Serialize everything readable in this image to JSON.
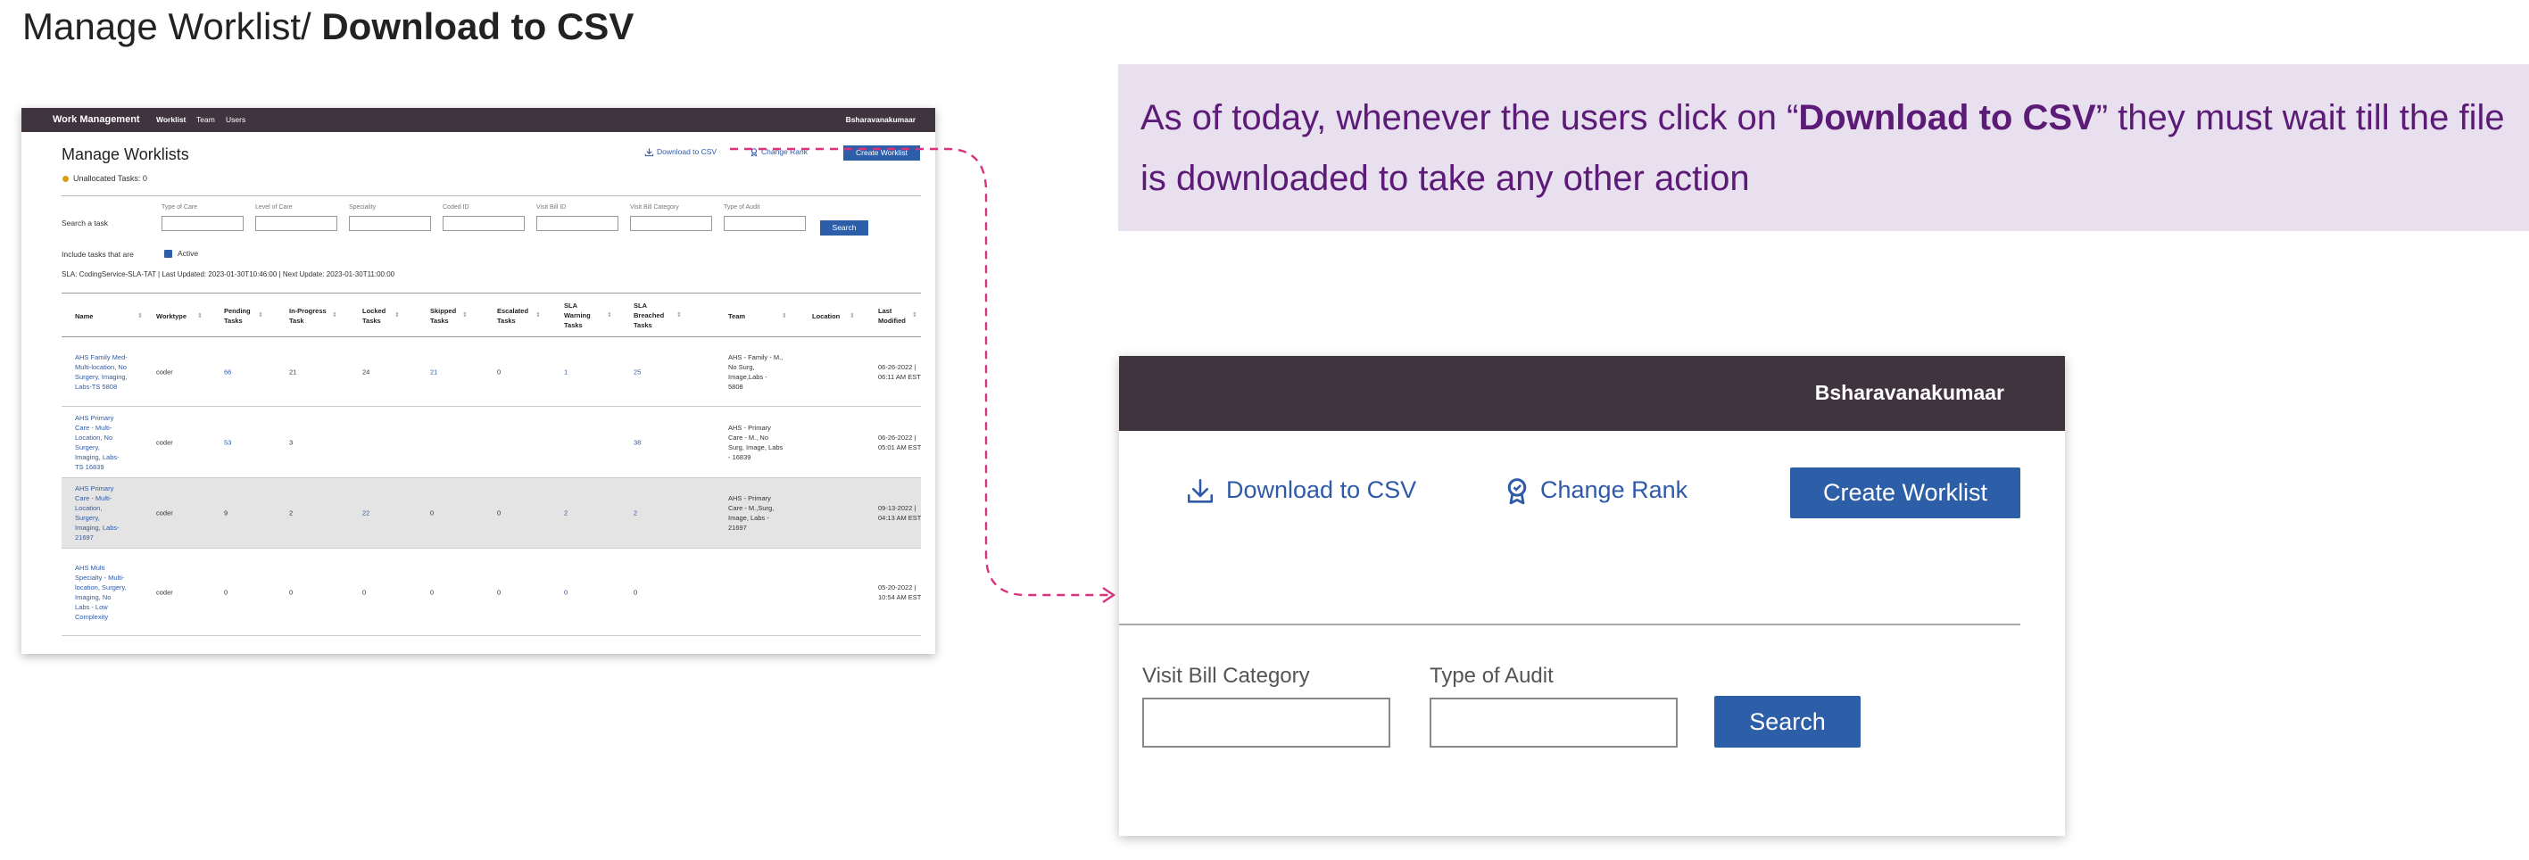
{
  "header": {
    "title_prefix": "Manage Worklist/ ",
    "title_bold": "Download to CSV"
  },
  "mini": {
    "nav": {
      "brand": "Work Management",
      "links": [
        "Worklist",
        "Team",
        "Users"
      ],
      "user": "Bsharavanakumaar"
    },
    "title": "Manage Worklists",
    "unallocated": "Unallocated Tasks: 0",
    "actions": {
      "download": "Download to CSV",
      "change_rank": "Change Rank",
      "create": "Create Worklist"
    },
    "search_label": "Search a task",
    "fields": [
      "Type of Care",
      "Level of Care",
      "Speciality",
      "Coded ID",
      "Visit Bill ID",
      "Visit Bill Category",
      "Type of Audit"
    ],
    "search_button": "Search",
    "include_label": "Include tasks that are",
    "active_label": "Active",
    "sla_line": "SLA: CodingService-SLA-TAT | Last Updated: 2023-01-30T10:46:00 | Next Update: 2023-01-30T11:00:00",
    "columns": [
      "Name",
      "Worktype",
      "Pending Tasks",
      "In-Progress Task",
      "Locked Tasks",
      "Skipped Tasks",
      "Escalated Tasks",
      "SLA Warning Tasks",
      "SLA Breached Tasks",
      "Team",
      "Location",
      "Last Modified"
    ],
    "rows": [
      {
        "name": "AHS Family Med-Multi-location, No Surgery, Imaging, Labs-TS 5808",
        "worktype": "coder",
        "pending": "66",
        "inprogress": "21",
        "locked": "24",
        "skipped": "21",
        "escalated": "0",
        "sla_warning": "1",
        "sla_breached": "25",
        "team": "AHS - Family - M., No Surg, Image,Labs - 5808",
        "location": "",
        "modified": "06-26-2022 | 06:11 AM EST"
      },
      {
        "name": "AHS Primary Care - Multi-Location, No Surgery, Imaging, Labs-TS 16839",
        "worktype": "coder",
        "pending": "53",
        "inprogress": "3",
        "locked": "",
        "skipped": "",
        "escalated": "",
        "sla_warning": "",
        "sla_breached": "38",
        "team": "AHS - Primary Care - M., No Surg, Image, Labs - 16839",
        "location": "",
        "modified": "06-26-2022 | 05:01 AM EST"
      },
      {
        "name": "AHS Primary Care - Multi-Location, Surgery, Imaging, Labs-21697",
        "worktype": "coder",
        "pending": "9",
        "inprogress": "2",
        "locked": "22",
        "skipped": "0",
        "escalated": "0",
        "sla_warning": "2",
        "sla_breached": "2",
        "team": "AHS - Primary Care - M.,Surg, Image, Labs - 21697",
        "location": "",
        "modified": "09-13-2022 | 04:13 AM EST"
      },
      {
        "name": "AHS Multi Specialty - Multi-location, Surgery, Imaging, No Labs - Low Complexity",
        "worktype": "coder",
        "pending": "0",
        "inprogress": "0",
        "locked": "0",
        "skipped": "0",
        "escalated": "0",
        "sla_warning": "0",
        "sla_breached": "0",
        "team": "",
        "location": "",
        "modified": "05-20-2022 | 10:54 AM EST"
      }
    ]
  },
  "callout": {
    "text_before": "As of today, whenever the users click on “",
    "text_bold": "Download to CSV",
    "text_after": "” they must wait till the file is downloaded to take any other action"
  },
  "zoom": {
    "user": "Bsharavanakumaar",
    "download": "Download to CSV",
    "change_rank": "Change Rank",
    "create": "Create Worklist",
    "field1_label": "Visit Bill Category",
    "field2_label": "Type of Audit",
    "search": "Search"
  },
  "colors": {
    "nav": "#40343f",
    "accent_blue": "#2d5ea8",
    "link_blue": "#2e5aa8",
    "callout_bg": "#e8e0ee",
    "callout_text": "#5b1b77",
    "connector": "#d6337f"
  }
}
